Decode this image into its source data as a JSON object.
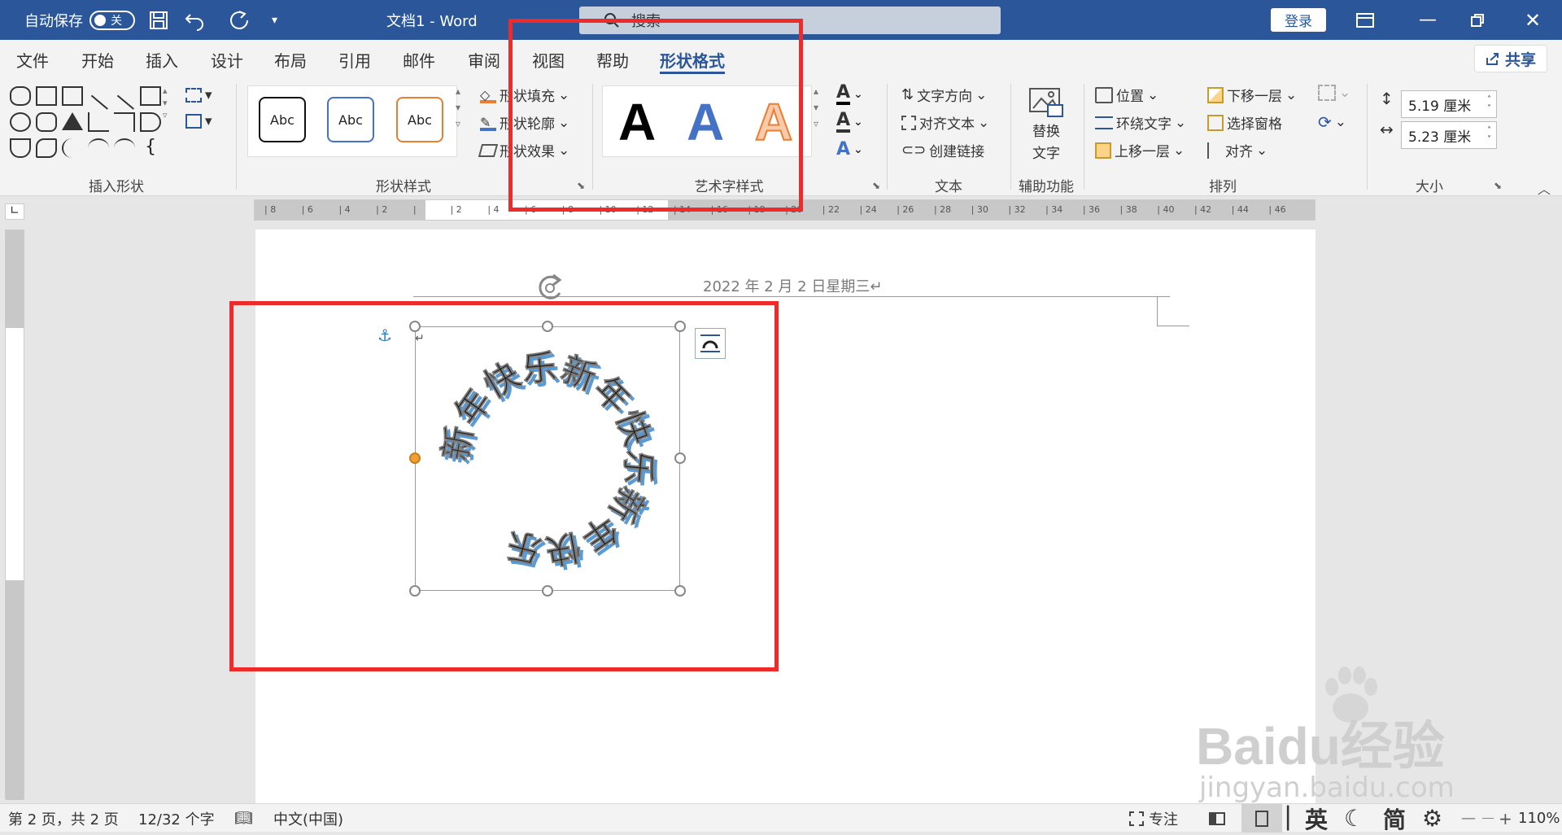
{
  "titlebar": {
    "autosave_label": "自动保存",
    "autosave_state": "关",
    "doc_title": "文档1  -  Word",
    "search_placeholder": "搜索",
    "login": "登录"
  },
  "menu": {
    "tabs": [
      "文件",
      "开始",
      "插入",
      "设计",
      "布局",
      "引用",
      "邮件",
      "审阅",
      "视图",
      "帮助",
      "形状格式"
    ],
    "active": "形状格式",
    "share": "共享"
  },
  "ribbon": {
    "groups": {
      "insert_shapes": "插入形状",
      "shape_styles": "形状样式",
      "wordart_styles": "艺术字样式",
      "text": "文本",
      "accessibility": "辅助功能",
      "arrange": "排列",
      "size": "大小"
    },
    "style_samples": [
      "Abc",
      "Abc",
      "Abc"
    ],
    "shape_fill": "形状填充",
    "shape_outline": "形状轮廓",
    "shape_effects": "形状效果",
    "wordart_sample": "A",
    "text_direction": "文字方向",
    "align_text": "对齐文本",
    "create_link": "创建链接",
    "alt_text_line1": "替换",
    "alt_text_line2": "文字",
    "position": "位置",
    "wrap_text": "环绕文字",
    "bring_forward": "上移一层",
    "send_backward": "下移一层",
    "selection_pane": "选择窗格",
    "align": "对齐",
    "height": "5.19 厘米",
    "width": "5.23 厘米"
  },
  "ruler": {
    "ticks": [
      "8",
      "6",
      "4",
      "2",
      "",
      "2",
      "4",
      "6",
      "8",
      "10",
      "12",
      "14",
      "16",
      "18",
      "20",
      "22",
      "24",
      "26",
      "28",
      "30",
      "32",
      "34",
      "36",
      "38",
      "40",
      "42",
      "44",
      "46"
    ]
  },
  "document": {
    "header_date": "2022 年 2 月 2 日星期三↵",
    "circle_text": "新年快乐新年快乐新年快乐",
    "return_mark": "↵"
  },
  "status": {
    "page": "第 2 页，共 2 页",
    "words": "12/32 个字",
    "language": "中文(中国)",
    "focus": "专注",
    "ime_english": "英",
    "ime_simplified": "简",
    "zoom": "110%"
  },
  "watermark": {
    "brand": "Baidu经验",
    "url": "jingyan.baidu.com"
  },
  "colors": {
    "word_blue": "#2b579a",
    "highlight_red": "#ee2b2b",
    "text_shadow_blue": "#5b9bd5"
  }
}
